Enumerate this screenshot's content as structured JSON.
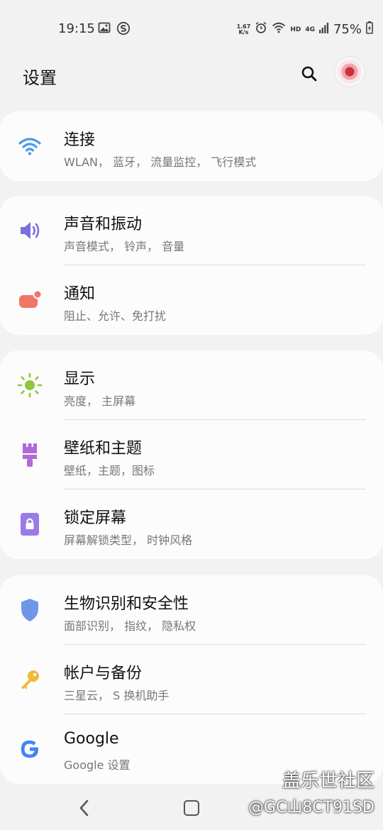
{
  "status_bar": {
    "time": "19:15",
    "speed_value": "1.67",
    "speed_unit": "K/s",
    "hd_label": "HD",
    "net_label": "4G",
    "battery": "75%"
  },
  "header": {
    "title": "设置"
  },
  "cards": [
    {
      "items": [
        {
          "title": "连接",
          "subtitle": "WLAN， 蓝牙， 流量监控， 飞行模式",
          "icon": "wifi-icon",
          "color": "#4a9be6"
        }
      ]
    },
    {
      "items": [
        {
          "title": "声音和振动",
          "subtitle": "声音模式， 铃声， 音量",
          "icon": "volume-icon",
          "color": "#7b6fe0"
        },
        {
          "title": "通知",
          "subtitle": "阻止、允许、免打扰",
          "icon": "notification-icon",
          "color": "#ef7565"
        }
      ]
    },
    {
      "items": [
        {
          "title": "显示",
          "subtitle": "亮度， 主屏幕",
          "icon": "brightness-icon",
          "color": "#8dc63f"
        },
        {
          "title": "壁纸和主题",
          "subtitle": "壁纸，主题，图标",
          "icon": "paintbrush-icon",
          "color": "#b06ad8"
        },
        {
          "title": "锁定屏幕",
          "subtitle": "屏幕解锁类型， 时钟风格",
          "icon": "lock-icon",
          "color": "#9a7be8"
        }
      ]
    },
    {
      "items": [
        {
          "title": "生物识别和安全性",
          "subtitle": "面部识别， 指纹， 隐私权",
          "icon": "shield-icon",
          "color": "#6f96e8"
        },
        {
          "title": "帐户与备份",
          "subtitle": "三星云， S 换机助手",
          "icon": "key-icon",
          "color": "#f0b93a"
        },
        {
          "title": "Google",
          "subtitle": "Google 设置",
          "icon": "google-icon",
          "color": "#4285f4"
        }
      ]
    }
  ],
  "watermark": {
    "line1": "盖乐世社区",
    "line2": "@GC山8CT91SD"
  }
}
